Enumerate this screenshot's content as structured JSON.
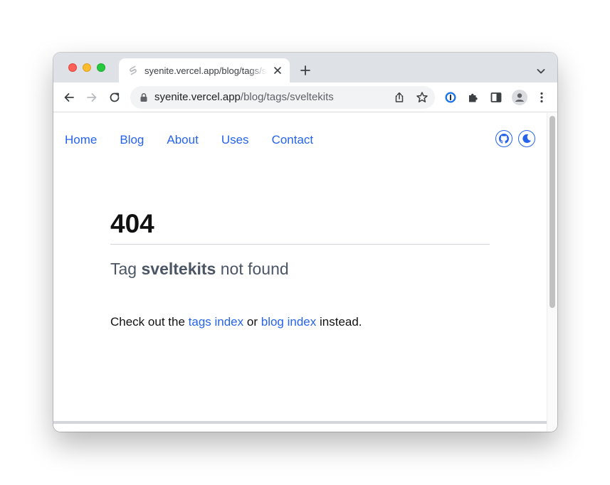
{
  "browser": {
    "tab": {
      "title": "syenite.vercel.app/blog/tags/sveltekits"
    },
    "address": {
      "host": "syenite.vercel.app",
      "path": "/blog/tags/sveltekits"
    }
  },
  "site": {
    "nav": [
      {
        "label": "Home"
      },
      {
        "label": "Blog"
      },
      {
        "label": "About"
      },
      {
        "label": "Uses"
      },
      {
        "label": "Contact"
      }
    ],
    "accent_color": "#2563eb"
  },
  "error": {
    "code": "404",
    "message_prefix": "Tag",
    "tag": "sveltekits",
    "message_suffix": "not found",
    "help_prefix": "Check out the",
    "tags_link": "tags index",
    "help_middle": "or",
    "blog_link": "blog index",
    "help_suffix": "instead."
  },
  "icons": [
    "sveltekit-favicon-icon",
    "lock-icon",
    "share-icon",
    "star-icon",
    "onepassword-icon",
    "extensions-icon",
    "side-panel-icon",
    "profile-icon",
    "more-icon",
    "github-icon",
    "moon-icon"
  ]
}
